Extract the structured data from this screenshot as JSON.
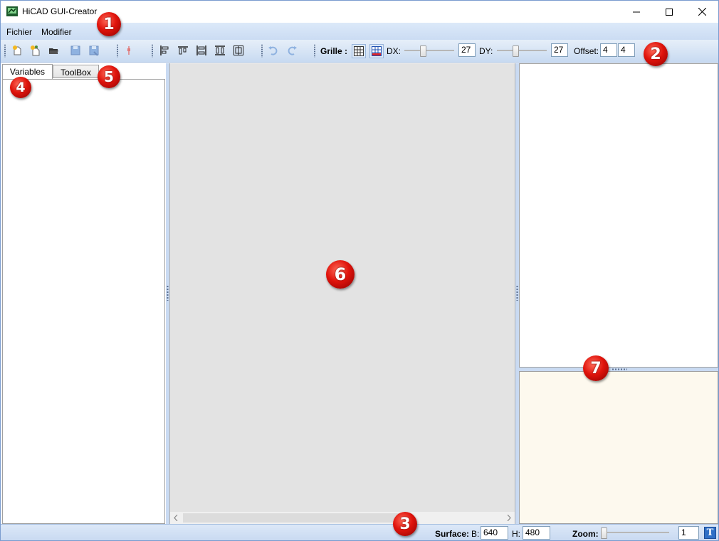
{
  "window": {
    "title": "HiCAD GUI-Creator",
    "controls": {
      "minimize_icon": "minimize-icon",
      "maximize_icon": "maximize-icon",
      "close_icon": "close-icon"
    }
  },
  "menu": {
    "items": [
      "Fichier",
      "Modifier"
    ]
  },
  "toolbar": {
    "grid_label": "Grille :",
    "dx_label": "DX:",
    "dx_value": "27",
    "dy_label": "DY:",
    "dy_value": "27",
    "offset_label": "Offset:",
    "offset_x": "4",
    "offset_y": "4",
    "icons": [
      "new-icon",
      "new-wizard-icon",
      "open-icon",
      "save-icon",
      "save-as-icon",
      "pin-icon",
      "align-left-icon",
      "align-top-icon",
      "distribute-vertical-icon",
      "distribute-horizontal-icon",
      "center-icon",
      "undo-icon",
      "redo-icon",
      "grid-icon",
      "snap-grid-icon"
    ]
  },
  "left_panel": {
    "tabs": [
      {
        "label": "Variables",
        "active": true
      },
      {
        "label": "ToolBox",
        "active": false
      }
    ]
  },
  "status": {
    "surface_label": "Surface:",
    "b_label": "B:",
    "b_value": "640",
    "h_label": "H:",
    "h_value": "480",
    "zoom_label": "Zoom:",
    "zoom_value": "1",
    "text_button_label": "T"
  },
  "callouts": [
    "1",
    "2",
    "3",
    "4",
    "5",
    "6",
    "7"
  ],
  "colors": {
    "accent": "#2f6fc6",
    "callout": "#e0140c",
    "bottom_panel": "#fdf9ee"
  }
}
